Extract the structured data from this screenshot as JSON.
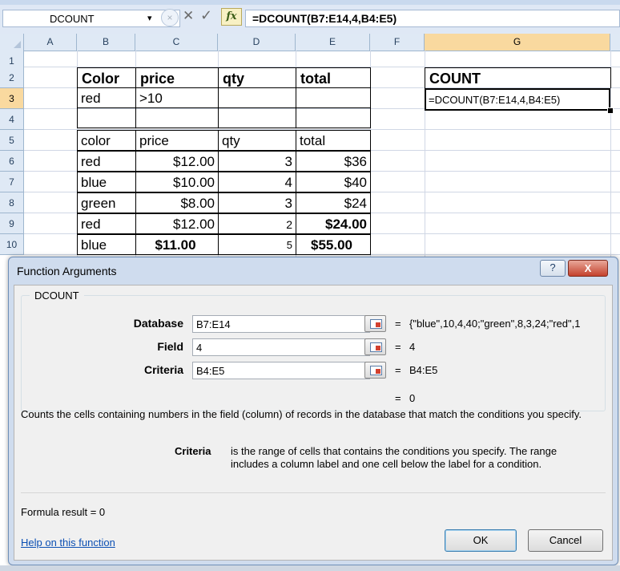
{
  "formula_bar": {
    "name_box": "DCOUNT",
    "name_box_arrow": "▾",
    "cancel_glyph": "×",
    "x_glyph": "✕",
    "check_glyph": "✓",
    "fx_label": "fx",
    "formula": "=DCOUNT(B7:E14,4,B4:E5)"
  },
  "columns": [
    "A",
    "B",
    "C",
    "D",
    "E",
    "F",
    "G"
  ],
  "selected_column": "G",
  "rows": [
    "1",
    "2",
    "3",
    "4",
    "5",
    "6",
    "7",
    "8",
    "9",
    "10"
  ],
  "selected_row": "3",
  "criteria_table": {
    "headers": [
      "Color",
      "price",
      "qty",
      "total"
    ],
    "values": [
      "red",
      ">10",
      "",
      ""
    ]
  },
  "database_table": {
    "headers": [
      "color",
      "price",
      "qty",
      "total"
    ],
    "rows": [
      [
        "red",
        "$12.00",
        "3",
        "$36"
      ],
      [
        "blue",
        "$10.00",
        "4",
        "$40"
      ],
      [
        "green",
        "$8.00",
        "3",
        "$24"
      ],
      [
        "red",
        "$12.00",
        "2",
        "$24.00"
      ],
      [
        "blue",
        "$11.00",
        "5",
        "$55.00"
      ]
    ]
  },
  "count_header": "COUNT",
  "active_cell_text": "=DCOUNT(B7:E14,4,B4:E5)",
  "dialog": {
    "title": "Function Arguments",
    "help_glyph": "?",
    "close_glyph": "X",
    "function_name": "DCOUNT",
    "args": [
      {
        "label": "Database",
        "value": "B7:E14",
        "result": "{\"blue\",10,4,40;\"green\",8,3,24;\"red\",1"
      },
      {
        "label": "Field",
        "value": "4",
        "result": "4"
      },
      {
        "label": "Criteria",
        "value": "B4:E5",
        "result": "B4:E5"
      }
    ],
    "eq": "=",
    "overall_result": "0",
    "description": "Counts the cells containing numbers in the field (column) of records in the database that match the conditions you specify.",
    "criteria_label": "Criteria",
    "criteria_description": "is the range of cells that contains the conditions you specify. The range includes a column label and one cell below the label for a condition.",
    "formula_result_label": "Formula result =",
    "formula_result_value": "0",
    "help_link": "Help on this function",
    "ok_label": "OK",
    "cancel_label": "Cancel"
  }
}
